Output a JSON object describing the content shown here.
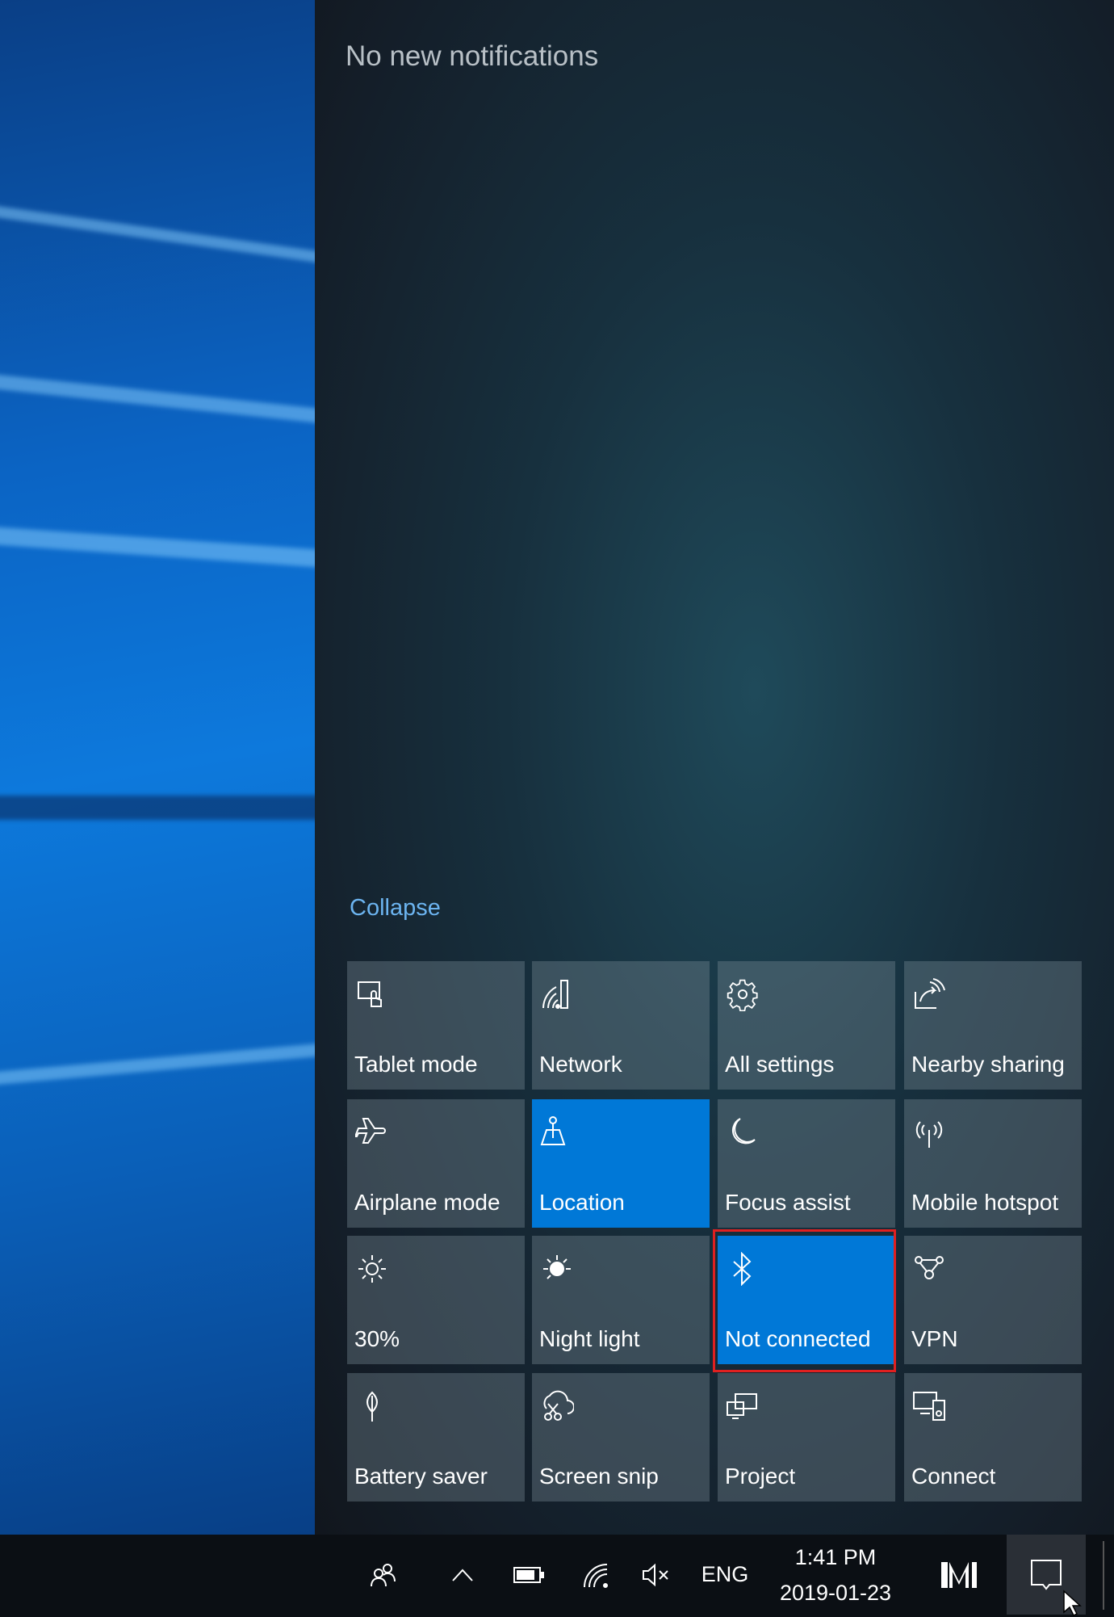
{
  "notifications": {
    "empty_text": "No new notifications"
  },
  "collapse_label": "Collapse",
  "tiles": [
    {
      "label": "Tablet mode",
      "icon": "tablet-mode-icon",
      "active": false
    },
    {
      "label": "Network",
      "icon": "network-icon",
      "active": false
    },
    {
      "label": "All settings",
      "icon": "gear-icon",
      "active": false
    },
    {
      "label": "Nearby sharing",
      "icon": "share-icon",
      "active": false
    },
    {
      "label": "Airplane mode",
      "icon": "airplane-icon",
      "active": false
    },
    {
      "label": "Location",
      "icon": "location-icon",
      "active": true
    },
    {
      "label": "Focus assist",
      "icon": "moon-icon",
      "active": false
    },
    {
      "label": "Mobile hotspot",
      "icon": "hotspot-icon",
      "active": false
    },
    {
      "label": "30%",
      "icon": "brightness-icon",
      "active": false
    },
    {
      "label": "Night light",
      "icon": "night-light-icon",
      "active": false
    },
    {
      "label": "Not connected",
      "icon": "bluetooth-icon",
      "active": true
    },
    {
      "label": "VPN",
      "icon": "vpn-icon",
      "active": false
    },
    {
      "label": "Battery saver",
      "icon": "battery-saver-icon",
      "active": false
    },
    {
      "label": "Screen snip",
      "icon": "screen-snip-icon",
      "active": false
    },
    {
      "label": "Project",
      "icon": "project-icon",
      "active": false
    },
    {
      "label": "Connect",
      "icon": "connect-icon",
      "active": false
    }
  ],
  "taskbar": {
    "language": "ENG",
    "time": "1:41 PM",
    "date": "2019-01-23"
  },
  "colors": {
    "accent": "#0078d7",
    "highlight": "#e02020"
  }
}
